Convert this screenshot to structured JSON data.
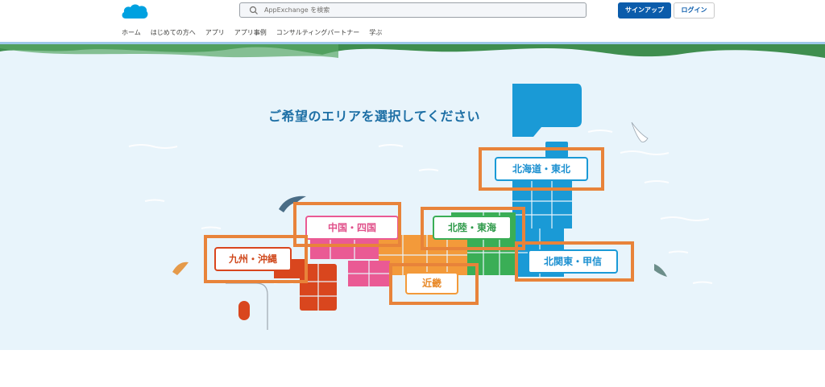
{
  "header": {
    "logo_icon": "salesforce-cloud-icon",
    "search_placeholder": "AppExchange を検索",
    "signup_label": "サインアップ",
    "login_label": "ログイン",
    "nav": [
      "ホーム",
      "はじめての方へ",
      "アプリ",
      "アプリ事例",
      "コンサルティングパートナー",
      "学ぶ"
    ]
  },
  "hero": {
    "headline": "ご希望のエリアを選択してください",
    "regions": {
      "hokkaido_tohoku": "北海道・東北",
      "chugoku_shikoku": "中国・四国",
      "hokuriku_tokai": "北陸・東海",
      "kyushu_okinawa": "九州・沖縄",
      "kitakanto_koshin": "北関東・甲信",
      "kinki": "近畿"
    }
  },
  "colors": {
    "brand_blue": "#0b5cab",
    "sky": "#e8f4fb",
    "hokkaido": "#1a9ad6",
    "tohoku_kanto": "#1a9ad6",
    "hokuriku": "#3aae56",
    "chugoku": "#ea5a94",
    "kinki": "#f39a3a",
    "kyushu": "#d9461e",
    "highlight": "#e8833a"
  }
}
